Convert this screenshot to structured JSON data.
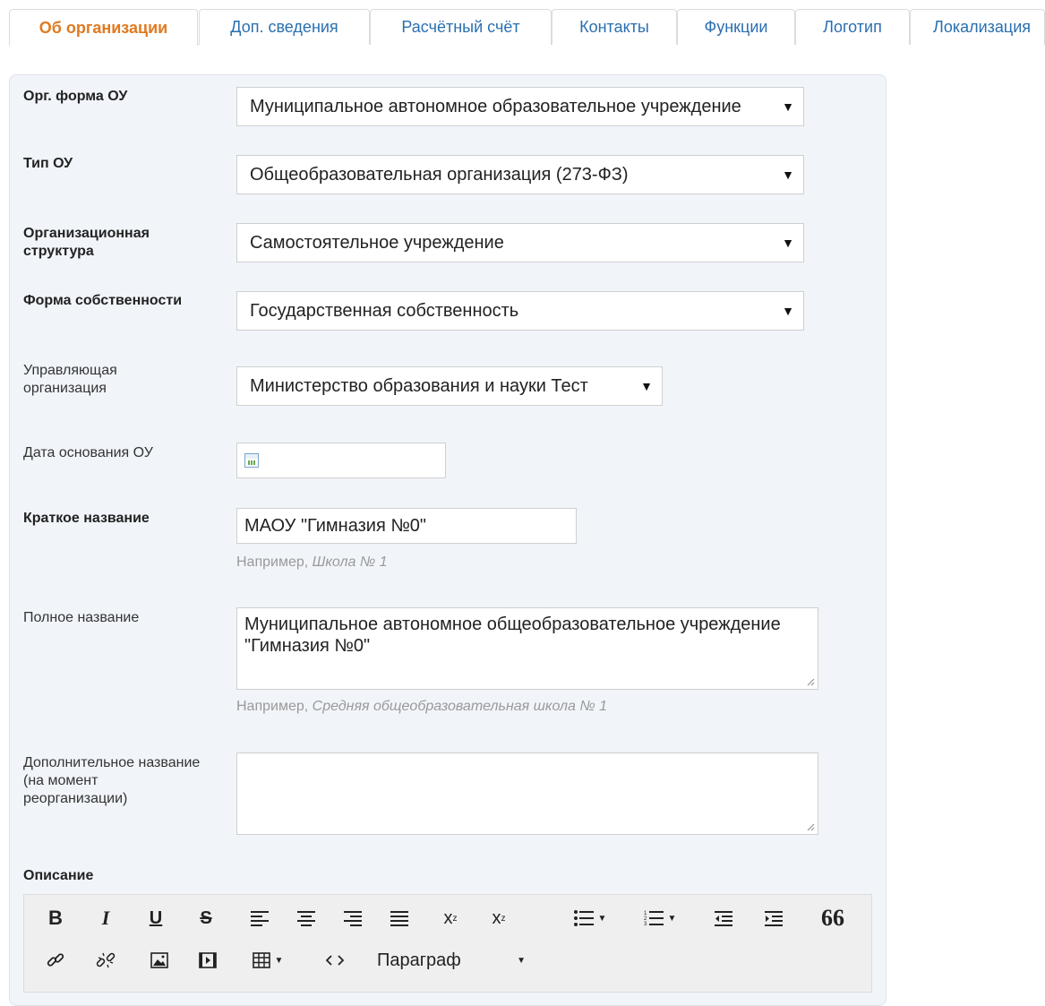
{
  "tabs": [
    {
      "label": "Об организации",
      "active": true
    },
    {
      "label": "Доп. сведения",
      "active": false
    },
    {
      "label": "Расчётный счёт",
      "active": false
    },
    {
      "label": "Контакты",
      "active": false
    },
    {
      "label": "Функции",
      "active": false
    },
    {
      "label": "Логотип",
      "active": false
    },
    {
      "label": "Локализация",
      "active": false
    }
  ],
  "form": {
    "org_form": {
      "label": "Орг. форма ОУ",
      "value": "Муниципальное автономное образовательное учреждение"
    },
    "type": {
      "label": "Тип ОУ",
      "value": "Общеобразовательная организация (273-ФЗ)"
    },
    "structure": {
      "label": "Организационная структура",
      "value": "Самостоятельное учреждение"
    },
    "ownership": {
      "label": "Форма собственности",
      "value": "Государственная собственность"
    },
    "managing": {
      "label": "Управляющая организация",
      "value": "Министерство образования и науки Тест"
    },
    "founded": {
      "label": "Дата основания ОУ",
      "value": ""
    },
    "short_name": {
      "label": "Краткое название",
      "value": "МАОУ \"Гимназия №0\"",
      "hint_prefix": "Например, ",
      "hint_example": "Школа № 1"
    },
    "full_name": {
      "label": "Полное название",
      "value": "Муниципальное автономное общеобразовательное учреждение \"Гимназия №0\"",
      "hint_prefix": "Например, ",
      "hint_example": "Средняя общеобразовательная школа № 1"
    },
    "extra_name": {
      "label": "Дополнительное название (на момент реорганизации)",
      "value": ""
    },
    "description": {
      "label": "Описание"
    }
  },
  "editor": {
    "bold": "B",
    "italic": "I",
    "underline": "U",
    "strike": "S",
    "subscript": "x",
    "superscript": "x",
    "blockquote": "66",
    "format_select": "Параграф"
  }
}
